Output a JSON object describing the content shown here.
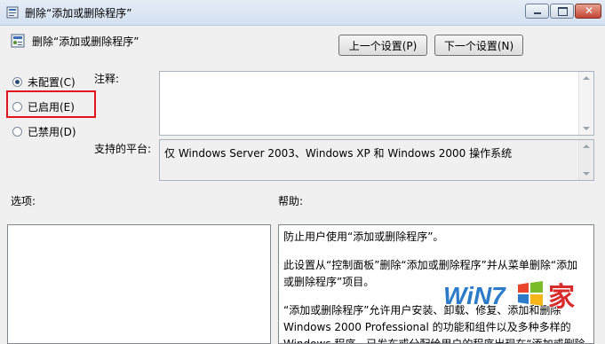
{
  "window": {
    "title": "删除“添加或删除程序”"
  },
  "header": {
    "policy_title": "删除“添加或删除程序”",
    "prev_button": "上一个设置(P)",
    "next_button": "下一个设置(N)"
  },
  "options": [
    {
      "label": "未配置(C)",
      "checked": true
    },
    {
      "label": "已启用(E)",
      "checked": false
    },
    {
      "label": "已禁用(D)",
      "checked": false
    }
  ],
  "labels": {
    "comment": "注释:",
    "supported_on": "支持的平台:",
    "options": "选项:",
    "help": "帮助:"
  },
  "supported_platform": "仅 Windows Server 2003、Windows XP 和 Windows 2000 操作系统",
  "help_text": [
    "防止用户使用“添加或删除程序”。",
    "此设置从“控制面板”删除“添加或删除程序”并从菜单删除“添加或删除程序”项目。",
    "“添加或删除程序”允许用户安装、卸载、修复、添加和删除 Windows 2000 Professional 的功能和组件以及多种多样的 Windows 程序。已发布或分配给用户的程序出现在“添加或删除"
  ],
  "watermark": {
    "text_win": "WiN7",
    "text_home": "家"
  }
}
